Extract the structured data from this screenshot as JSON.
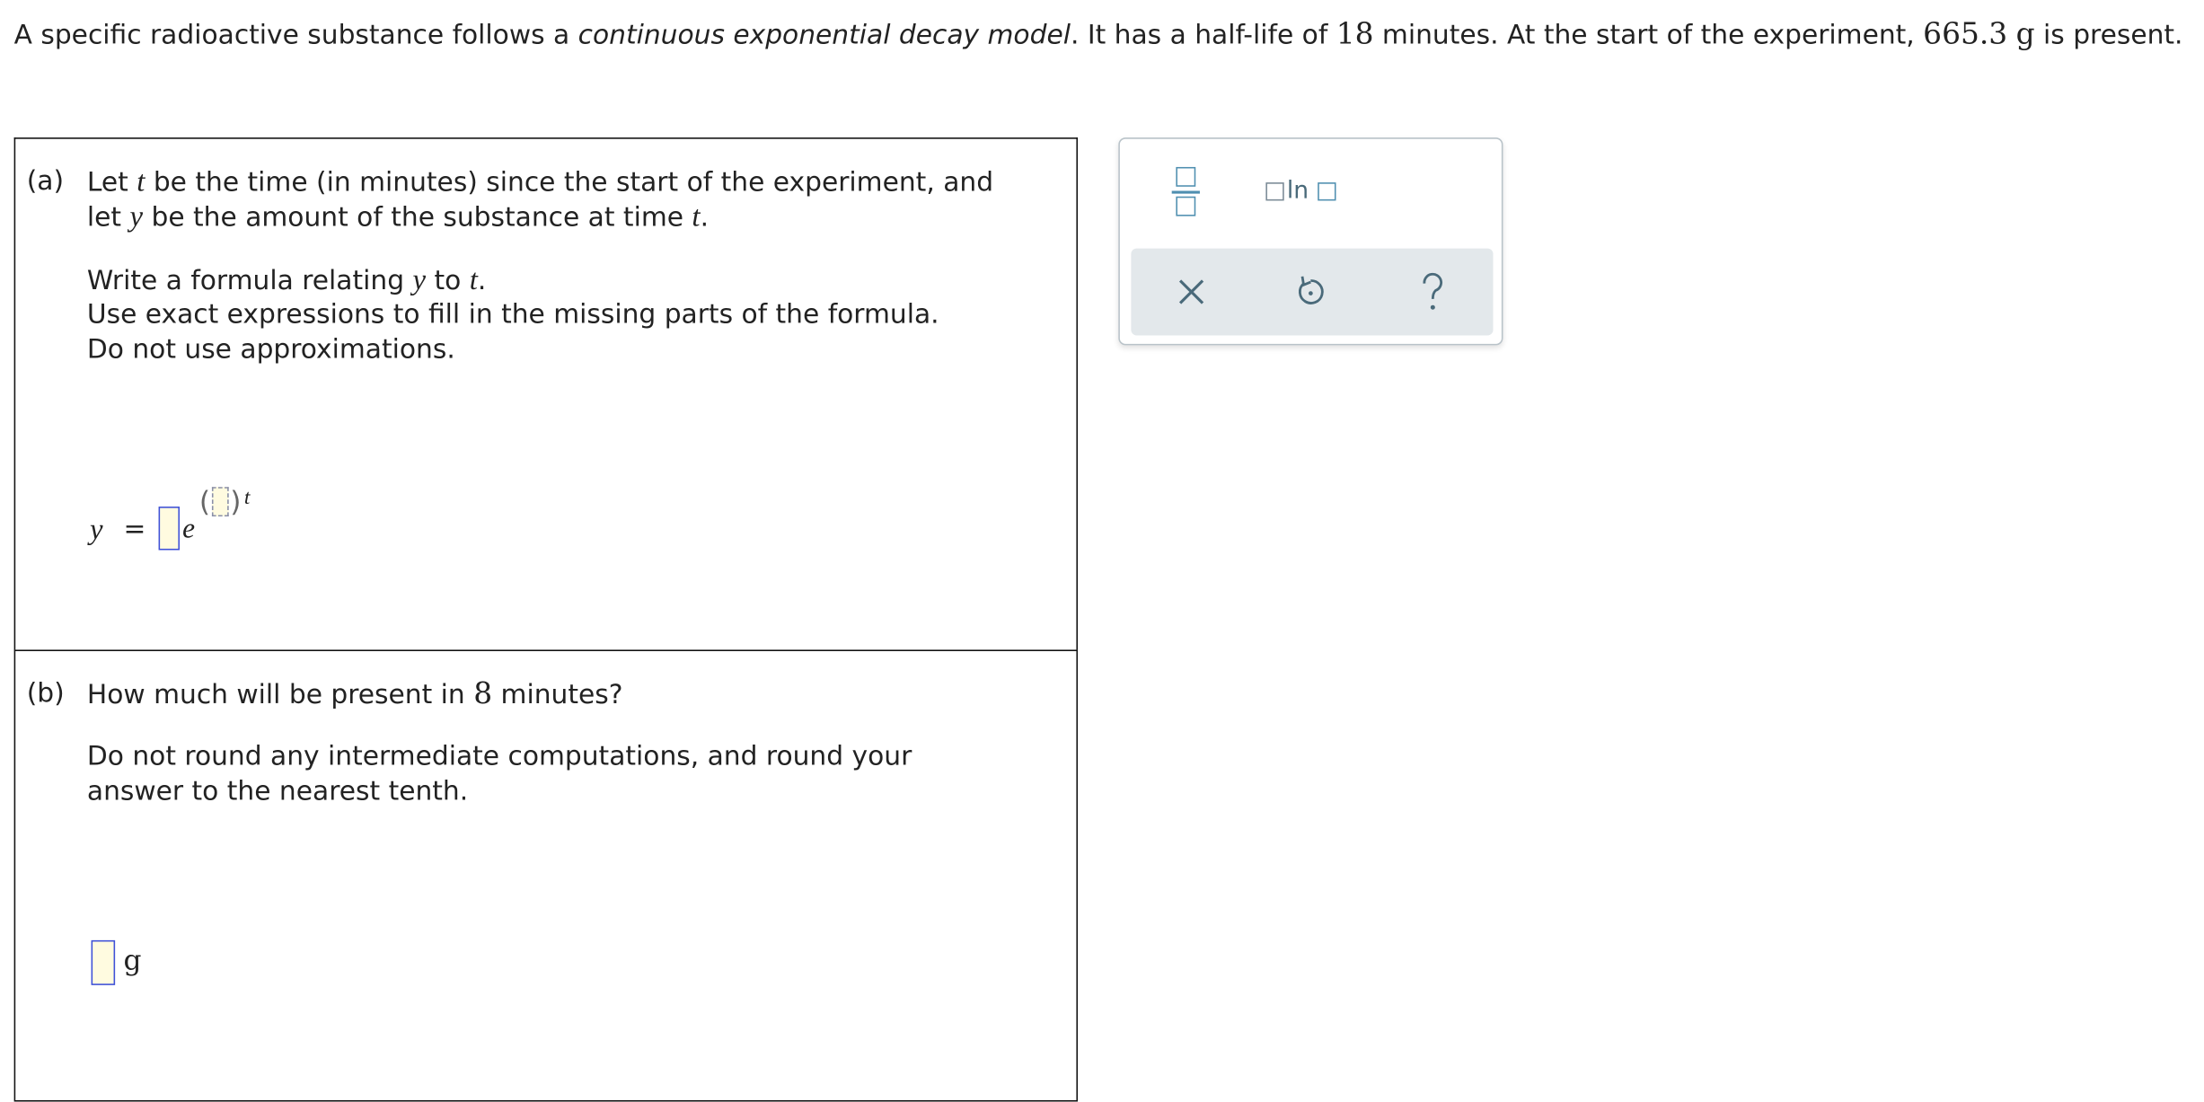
{
  "intro": {
    "t1": "A specific radioactive substance follows a ",
    "model": "continuous exponential decay model",
    "t2": ". It has a half-life of ",
    "half_life": "18",
    "t3": " minutes. At the start of the experiment, ",
    "initial_amount": "665.3",
    "t4": " ",
    "unit": "g",
    "t5": " is present."
  },
  "part_a": {
    "label": "(a)",
    "l1_a": "Let ",
    "var_t": "t",
    "l1_b": " be the time (in minutes) since the start of the experiment, and",
    "l2_a": "let ",
    "var_y": "y",
    "l2_b": " be the amount of the substance at time ",
    "l2_t": "t",
    "l2_c": ".",
    "l3_a": "Write a formula relating ",
    "l3_y": "y",
    "l3_b": " to ",
    "l3_t": "t",
    "l3_c": ".",
    "l4": "Use exact expressions to fill in the missing parts of the formula.",
    "l5": "Do not use approximations.",
    "formula": {
      "lhs": "y",
      "eq": "=",
      "base": "e",
      "exp_var": "t"
    }
  },
  "part_b": {
    "label": "(b)",
    "q_a": "How much will be present in ",
    "minutes": "8",
    "q_b": " minutes?",
    "inst1": "Do not round any intermediate computations, and round your",
    "inst2": "answer to the nearest tenth.",
    "unit": "g"
  },
  "palette": {
    "ln_label": "ln",
    "tools": [
      "fraction-icon",
      "ln-icon",
      "clear-icon",
      "undo-icon",
      "help-icon"
    ]
  },
  "colors": {
    "answer_border": "#3f51d8",
    "answer_fill": "#fffbe0",
    "palette_icon": "#4f8fb0",
    "palette_bar": "#e3e8eb",
    "action_icon": "#4a6a7a"
  }
}
